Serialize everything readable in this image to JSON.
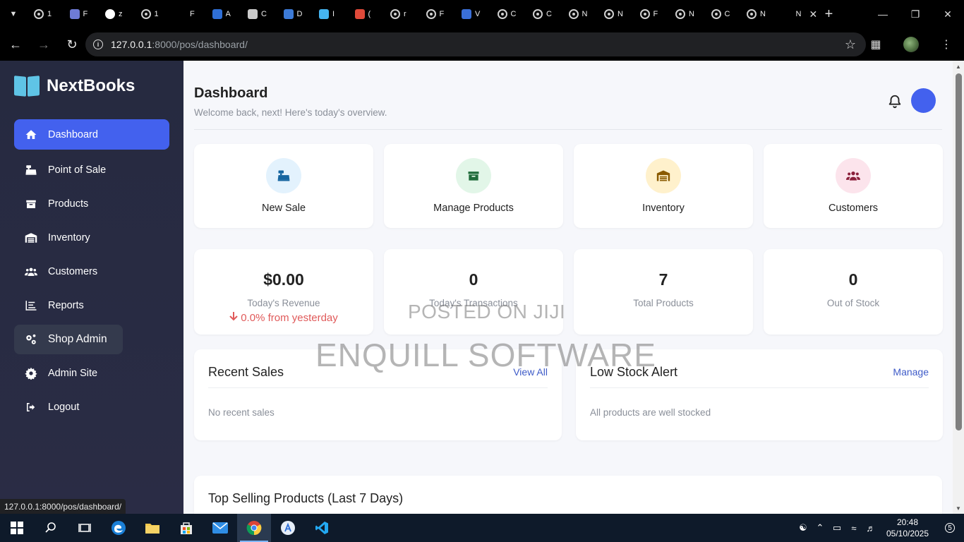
{
  "browser": {
    "tabs": [
      {
        "icon": "globe-icon",
        "title": "1"
      },
      {
        "icon": "django-icon",
        "title": "F"
      },
      {
        "icon": "github-icon",
        "title": "z"
      },
      {
        "icon": "globe-icon",
        "title": "1"
      },
      {
        "icon": "blank-icon",
        "title": "F"
      },
      {
        "icon": "app-icon",
        "title": "A"
      },
      {
        "icon": "refresh-icon",
        "title": "C"
      },
      {
        "icon": "download-icon",
        "title": "D"
      },
      {
        "icon": "flutter-icon",
        "title": "I"
      },
      {
        "icon": "gmail-icon",
        "title": "("
      },
      {
        "icon": "globe-icon",
        "title": "r"
      },
      {
        "icon": "globe-icon",
        "title": "F"
      },
      {
        "icon": "shark-icon",
        "title": "V"
      },
      {
        "icon": "globe-icon",
        "title": "C"
      },
      {
        "icon": "globe-icon",
        "title": "C"
      },
      {
        "icon": "globe-icon",
        "title": "N"
      },
      {
        "icon": "globe-icon",
        "title": "N"
      },
      {
        "icon": "globe-icon",
        "title": "F"
      },
      {
        "icon": "globe-icon",
        "title": "N"
      },
      {
        "icon": "globe-icon",
        "title": "C"
      },
      {
        "icon": "globe-icon",
        "title": "N"
      },
      {
        "icon": "blank-icon",
        "title": "N"
      }
    ],
    "url_host": "127.0.0.1",
    "url_path": ":8000/pos/dashboard/",
    "status_url": "127.0.0.1:8000/pos/dashboard/"
  },
  "sidebar": {
    "brand": "NextBooks",
    "items": [
      {
        "label": "Dashboard",
        "icon": "home-icon"
      },
      {
        "label": "Point of Sale",
        "icon": "cash-register-icon"
      },
      {
        "label": "Products",
        "icon": "box-icon"
      },
      {
        "label": "Inventory",
        "icon": "warehouse-icon"
      },
      {
        "label": "Customers",
        "icon": "users-icon"
      },
      {
        "label": "Reports",
        "icon": "chart-icon"
      },
      {
        "label": "Shop Admin",
        "icon": "cogs-icon"
      },
      {
        "label": "Admin Site",
        "icon": "gear-icon"
      },
      {
        "label": "Logout",
        "icon": "logout-icon"
      }
    ]
  },
  "header": {
    "title": "Dashboard",
    "subtitle": "Welcome back, next! Here's today's overview."
  },
  "quick_actions": [
    {
      "label": "New Sale",
      "icon": "cash-register-icon",
      "bg": "#e3f2fd",
      "fg": "#1565a0"
    },
    {
      "label": "Manage Products",
      "icon": "box-icon",
      "bg": "#e2f6e8",
      "fg": "#1f6b3a"
    },
    {
      "label": "Inventory",
      "icon": "warehouse-icon",
      "bg": "#fff1cc",
      "fg": "#8a5a00"
    },
    {
      "label": "Customers",
      "icon": "users-icon",
      "bg": "#fce4ec",
      "fg": "#8a1f3a"
    }
  ],
  "stats": [
    {
      "value": "$0.00",
      "label": "Today's Revenue",
      "change": "0.0% from yesterday"
    },
    {
      "value": "0",
      "label": "Today's Transactions"
    },
    {
      "value": "7",
      "label": "Total Products"
    },
    {
      "value": "0",
      "label": "Out of Stock"
    }
  ],
  "recent_sales": {
    "title": "Recent Sales",
    "link": "View All",
    "empty": "No recent sales"
  },
  "low_stock": {
    "title": "Low Stock Alert",
    "link": "Manage",
    "empty": "All products are well stocked"
  },
  "top_selling": {
    "title": "Top Selling Products (Last 7 Days)"
  },
  "watermark": {
    "line1": "POSTED ON JIJI",
    "line2": "ENQUILL SOFTWARE"
  },
  "taskbar": {
    "time": "20:48",
    "date": "05/10/2025",
    "notifications": "5"
  },
  "colors": {
    "accent": "#4361ee",
    "sidebar": "#2a2c45",
    "negative": "#e05a5a"
  }
}
